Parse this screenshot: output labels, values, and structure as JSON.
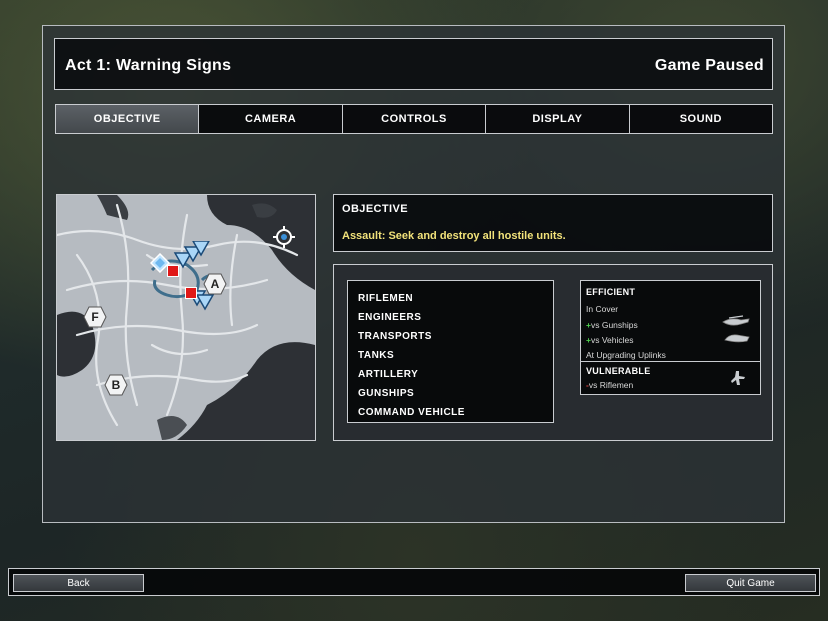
{
  "header": {
    "title": "Act 1: Warning Signs",
    "status": "Game Paused"
  },
  "tabs": [
    {
      "label": "OBJECTIVE",
      "active": true
    },
    {
      "label": "CAMERA",
      "active": false
    },
    {
      "label": "CONTROLS",
      "active": false
    },
    {
      "label": "DISPLAY",
      "active": false
    },
    {
      "label": "SOUND",
      "active": false
    }
  ],
  "map": {
    "markers": [
      "A",
      "F",
      "B"
    ],
    "icons": [
      "locate-icon",
      "player-diamond-icon",
      "enemy-flag-icon",
      "unit-chevron-icon"
    ]
  },
  "objective": {
    "title": "OBJECTIVE",
    "text": "Assault: Seek and destroy all hostile units.",
    "text_color": "#f2e27a"
  },
  "units": {
    "list": [
      "RIFLEMEN",
      "ENGINEERS",
      "TRANSPORTS",
      "TANKS",
      "ARTILLERY",
      "GUNSHIPS",
      "COMMAND VEHICLE"
    ],
    "efficient": {
      "title": "EFFICIENT",
      "rows": [
        {
          "prefix": "",
          "text": "In Cover"
        },
        {
          "prefix": "+",
          "text": "vs Gunships",
          "icon": "gunship-icon"
        },
        {
          "prefix": "+",
          "text": "vs Vehicles",
          "icon": "vehicle-icon"
        },
        {
          "prefix": "",
          "text": "At Upgrading Uplinks"
        }
      ]
    },
    "vulnerable": {
      "title": "VULNERABLE",
      "rows": [
        {
          "prefix": "-",
          "text": "vs Riflemen",
          "icon": "rifleman-icon"
        }
      ]
    },
    "colors": {
      "plus": "#4fd04f",
      "minus": "#e04040"
    }
  },
  "footer": {
    "back_label": "Back",
    "quit_label": "Quit Game"
  }
}
